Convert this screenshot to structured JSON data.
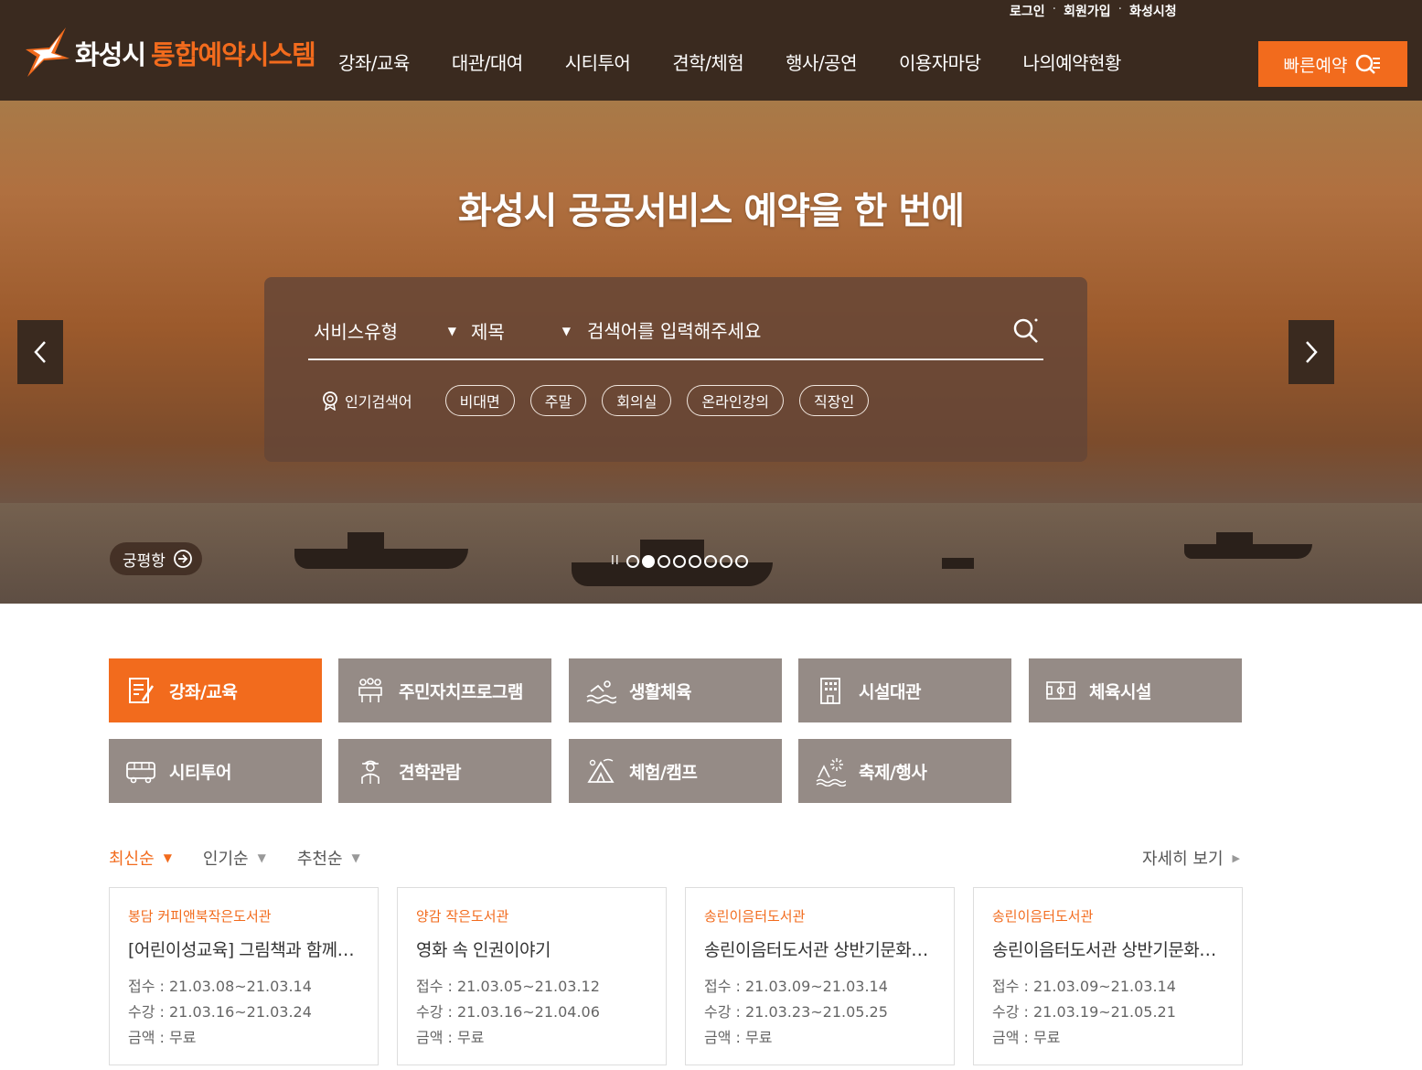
{
  "header": {
    "util_links": [
      "로그인",
      "회원가입",
      "화성시청"
    ],
    "logo_city": "화성시",
    "logo_system": "통합예약시스템",
    "nav": [
      "강좌/교육",
      "대관/대여",
      "시티투어",
      "견학/체험",
      "행사/공연",
      "이용자마당",
      "나의예약현황"
    ],
    "quick_label": "빠른예약"
  },
  "hero": {
    "title_pre": "화성시 ",
    "title_bold": "공공서비스 예약",
    "title_post": "을 한 번에",
    "search": {
      "type_select": "서비스유형",
      "field_select": "제목",
      "placeholder": "검색어를 입력해주세요"
    },
    "popular_label": "인기검색어",
    "popular_tags": [
      "비대면",
      "주말",
      "회의실",
      "온라인강의",
      "직장인"
    ],
    "place": "궁평항",
    "slide_count": 8,
    "active_slide": 2
  },
  "categories": [
    {
      "label": "강좌/교육",
      "icon": "document-pen-icon",
      "active": true
    },
    {
      "label": "주민자치프로그램",
      "icon": "people-group-icon",
      "active": false
    },
    {
      "label": "생활체육",
      "icon": "swimmer-icon",
      "active": false
    },
    {
      "label": "시설대관",
      "icon": "building-icon",
      "active": false
    },
    {
      "label": "체육시설",
      "icon": "field-icon",
      "active": false
    },
    {
      "label": "시티투어",
      "icon": "bus-icon",
      "active": false
    },
    {
      "label": "견학관람",
      "icon": "guide-icon",
      "active": false
    },
    {
      "label": "체험/캠프",
      "icon": "tent-icon",
      "active": false
    },
    {
      "label": "축제/행사",
      "icon": "fireworks-icon",
      "active": false
    }
  ],
  "sort": {
    "options": [
      "최신순",
      "인기순",
      "추천순"
    ],
    "active": 0,
    "more_label": "자세히 보기"
  },
  "cards": [
    {
      "org": "봉담 커피앤북작은도서관",
      "title": "[어린이성교육] 그림책과 함께하는",
      "reception": "접수 : 21.03.08~21.03.14",
      "course": "수강 : 21.03.16~21.03.24",
      "fee": "금액 : 무료"
    },
    {
      "org": "양감 작은도서관",
      "title": "영화 속 인권이야기",
      "reception": "접수 : 21.03.05~21.03.12",
      "course": "수강 : 21.03.16~21.04.06",
      "fee": "금액 : 무료"
    },
    {
      "org": "송린이음터도서관",
      "title": "송린이음터도서관 상반기문화강좌",
      "reception": "접수 : 21.03.09~21.03.14",
      "course": "수강 : 21.03.23~21.05.25",
      "fee": "금액 : 무료"
    },
    {
      "org": "송린이음터도서관",
      "title": "송린이음터도서관 상반기문화강좌",
      "reception": "접수 : 21.03.09~21.03.14",
      "course": "수강 : 21.03.19~21.05.21",
      "fee": "금액 : 무료"
    }
  ],
  "colors": {
    "accent": "#f26b1d",
    "header_bg": "#3a2a1f",
    "category_bg": "#958b86"
  }
}
